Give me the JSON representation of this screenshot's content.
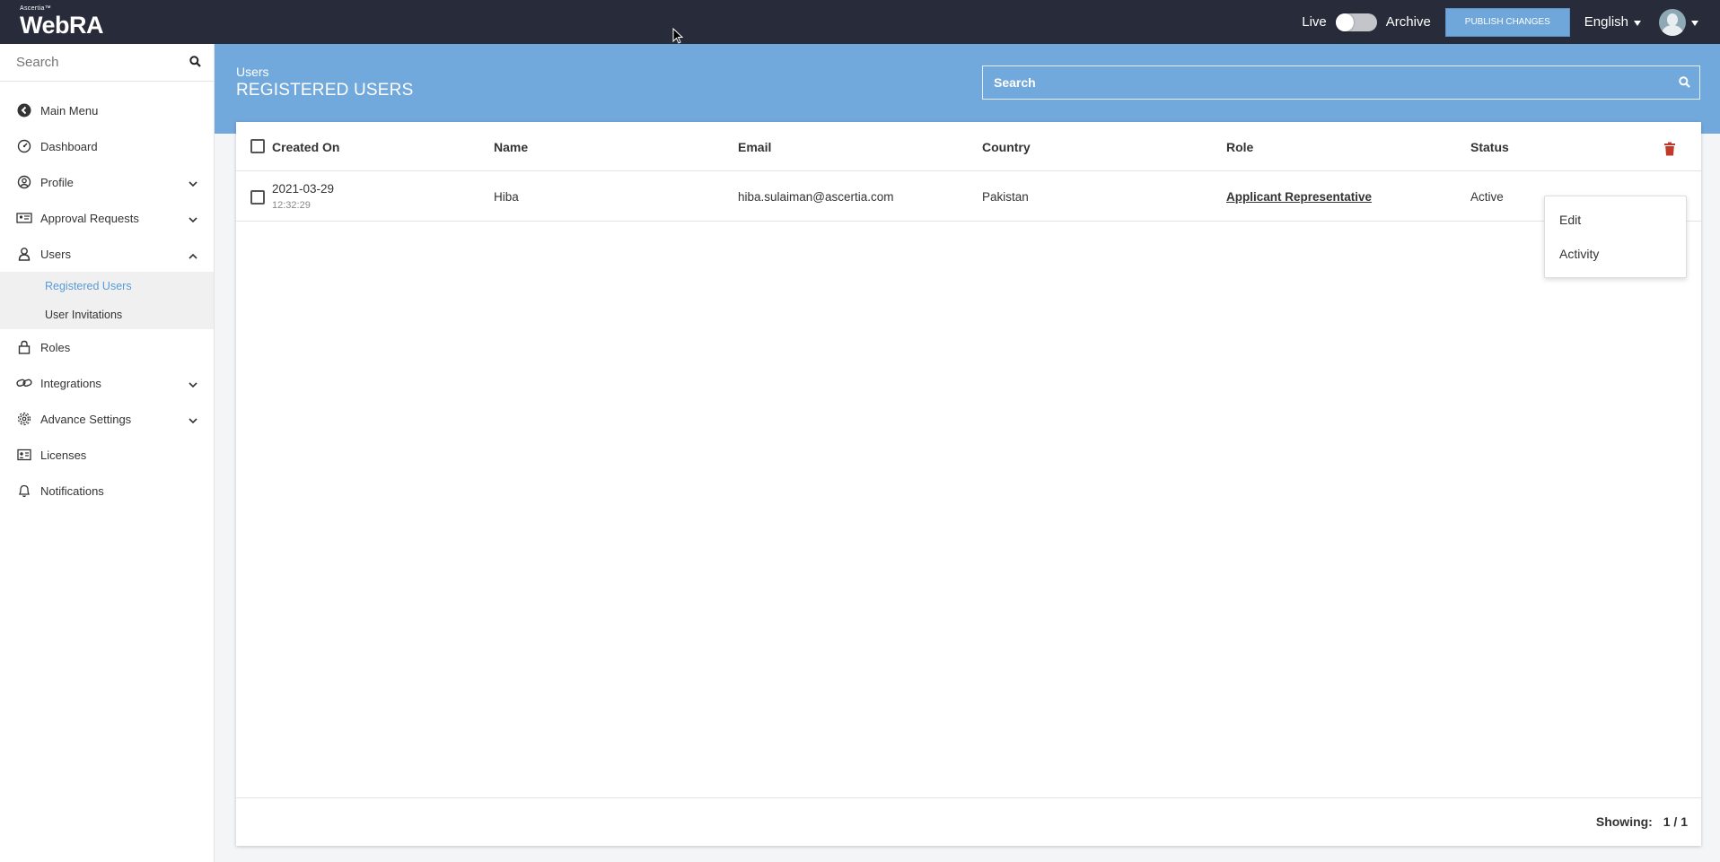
{
  "app": {
    "logo_small": "Ascertia™",
    "logo_big": "WebRA"
  },
  "topbar": {
    "live_label": "Live",
    "archive_label": "Archive",
    "publish_label": "PUBLISH CHANGES",
    "language": "English"
  },
  "sidebar": {
    "search_placeholder": "Search",
    "items": [
      {
        "label": "Main Menu"
      },
      {
        "label": "Dashboard"
      },
      {
        "label": "Profile"
      },
      {
        "label": "Approval Requests"
      },
      {
        "label": "Users"
      },
      {
        "label": "Roles"
      },
      {
        "label": "Integrations"
      },
      {
        "label": "Advance Settings"
      },
      {
        "label": "Licenses"
      },
      {
        "label": "Notifications"
      }
    ],
    "users_sub": [
      {
        "label": "Registered Users"
      },
      {
        "label": "User Invitations"
      }
    ]
  },
  "header": {
    "breadcrumb": "Users",
    "title": "REGISTERED USERS",
    "search_placeholder": "Search"
  },
  "table": {
    "columns": [
      "Created On",
      "Name",
      "Email",
      "Country",
      "Role",
      "Status"
    ],
    "rows": [
      {
        "date": "2021-03-29",
        "time": "12:32:29",
        "name": "Hiba",
        "email": "hiba.sulaiman@ascertia.com",
        "country": "Pakistan",
        "role": "Applicant Representative",
        "status": "Active"
      }
    ]
  },
  "row_menu": {
    "edit": "Edit",
    "activity": "Activity"
  },
  "footer": {
    "showing_label": "Showing:",
    "showing_value": "1 / 1"
  },
  "colors": {
    "topbar": "#272b3a",
    "accent": "#71a9dc",
    "delete": "#c0392b",
    "active_sub": "#5a9bd6"
  }
}
